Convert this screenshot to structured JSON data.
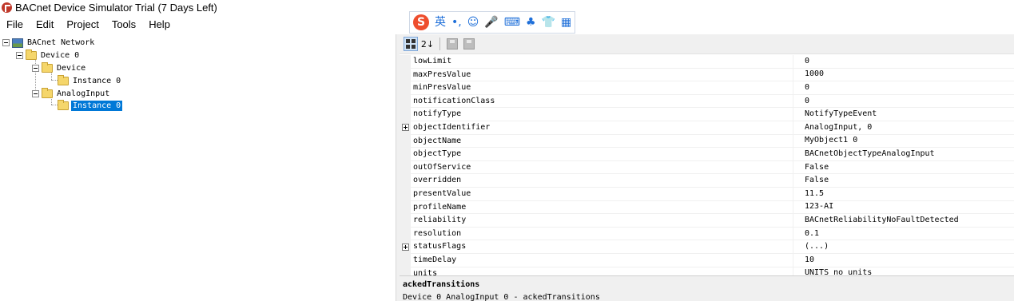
{
  "window": {
    "title": "BACnet Device Simulator Trial (7 Days Left)"
  },
  "menu": [
    "File",
    "Edit",
    "Project",
    "Tools",
    "Help"
  ],
  "ime_toolbar": {
    "logo": "S",
    "lang": "英",
    "punct": "•,",
    "emoji": "☺",
    "voice": "🎤",
    "keyboard": "⌨",
    "user": "♣",
    "skin": "👕",
    "apps": "▦"
  },
  "tree": {
    "nodes": [
      {
        "label": "BACnet Network",
        "icon": "network-icon",
        "expanded": true,
        "selected": false
      },
      {
        "label": "Device 0",
        "icon": "folder-icon",
        "expanded": true,
        "selected": false
      },
      {
        "label": "Device",
        "icon": "folder-icon",
        "expanded": true,
        "selected": false
      },
      {
        "label": "Instance 0",
        "icon": "folder-icon",
        "expanded": false,
        "selected": false
      },
      {
        "label": "AnalogInput",
        "icon": "folder-icon",
        "expanded": true,
        "selected": false
      },
      {
        "label": "Instance 0",
        "icon": "folder-icon",
        "expanded": false,
        "selected": true
      }
    ]
  },
  "prop_toolbar": {
    "categorized_icon": "grid-icon",
    "alphabetical_label": "2↓",
    "save_icon": "save-icon",
    "save_all_icon": "save-all-icon"
  },
  "properties": [
    {
      "name": "lowLimit",
      "value": "0",
      "expandable": false
    },
    {
      "name": "maxPresValue",
      "value": "1000",
      "expandable": false
    },
    {
      "name": "minPresValue",
      "value": "0",
      "expandable": false
    },
    {
      "name": "notificationClass",
      "value": "0",
      "expandable": false
    },
    {
      "name": "notifyType",
      "value": "NotifyTypeEvent",
      "expandable": false
    },
    {
      "name": "objectIdentifier",
      "value": "AnalogInput, 0",
      "expandable": true
    },
    {
      "name": "objectName",
      "value": "MyObject1 0",
      "expandable": false
    },
    {
      "name": "objectType",
      "value": "BACnetObjectTypeAnalogInput",
      "expandable": false
    },
    {
      "name": "outOfService",
      "value": "False",
      "expandable": false
    },
    {
      "name": "overridden",
      "value": "False",
      "expandable": false
    },
    {
      "name": "presentValue",
      "value": "11.5",
      "expandable": false
    },
    {
      "name": "profileName",
      "value": "123-AI",
      "expandable": false
    },
    {
      "name": "reliability",
      "value": "BACnetReliabilityNoFaultDetected",
      "expandable": false
    },
    {
      "name": "resolution",
      "value": "0.1",
      "expandable": false
    },
    {
      "name": "statusFlags",
      "value": "(...)",
      "expandable": true
    },
    {
      "name": "timeDelay",
      "value": "10",
      "expandable": false
    },
    {
      "name": "units",
      "value": "UNITS_no_units",
      "expandable": false
    }
  ],
  "description": {
    "title": "ackedTransitions",
    "text": "Device 0 AnalogInput 0 - ackedTransitions"
  },
  "colors": {
    "selection": "#0078d7",
    "app_icon": "#c0392b",
    "ime_logo": "#ee4d2d",
    "ime_glyph": "#1e6fd9"
  }
}
